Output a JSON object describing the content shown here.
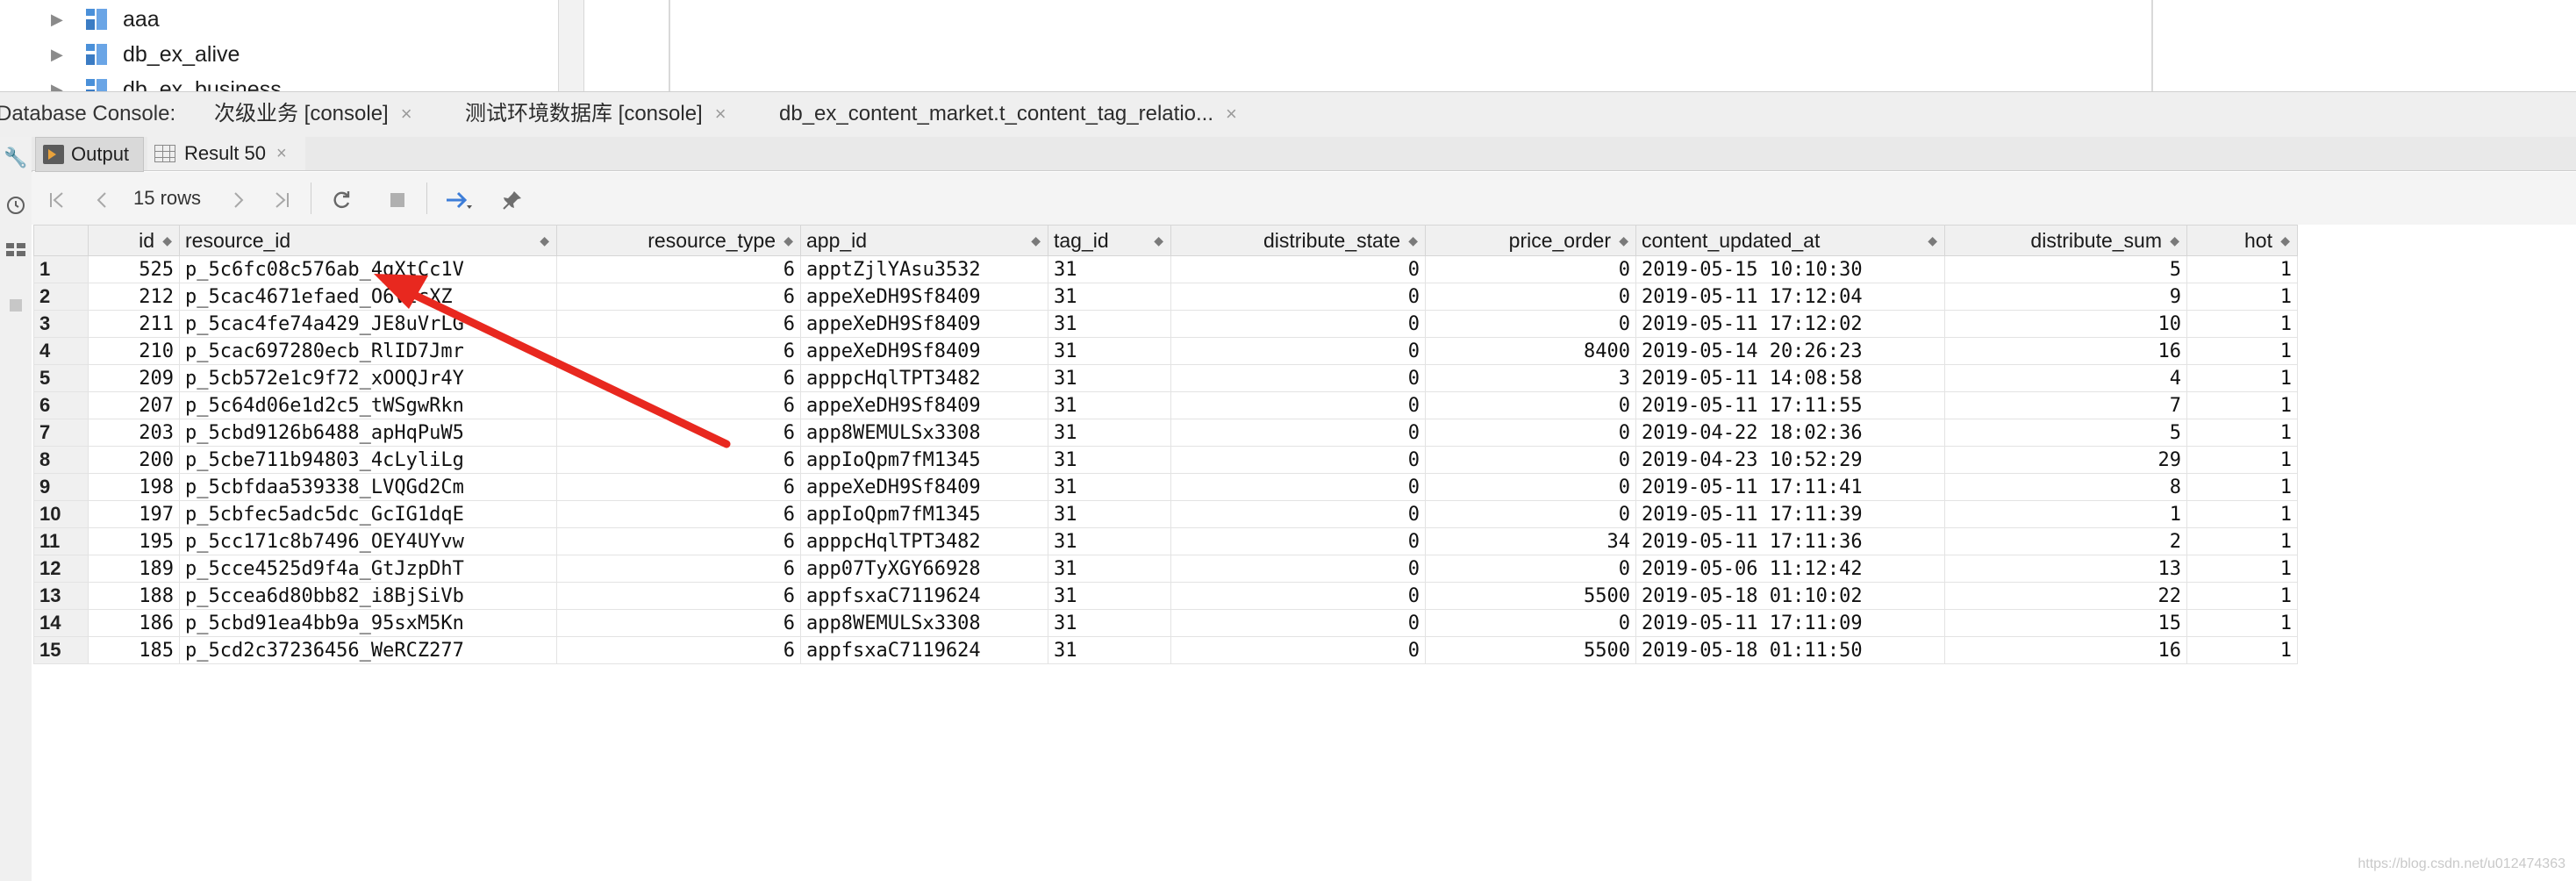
{
  "tree": {
    "items": [
      {
        "label": "aaa"
      },
      {
        "label": "db_ex_alive"
      },
      {
        "label": "db_ex_business"
      }
    ]
  },
  "console": {
    "label": "Database Console:",
    "tabs": [
      {
        "label": "次级业务 [console]"
      },
      {
        "label": "测试环境数据库 [console]"
      },
      {
        "label": "db_ex_content_market.t_content_tag_relatio..."
      }
    ],
    "close_glyph": "×"
  },
  "result_tabs": {
    "output_label": "Output",
    "result_label": "Result 50"
  },
  "toolbar": {
    "rows_label": "15 rows",
    "icons": [
      "first-page-icon",
      "prev-page-icon",
      "next-page-icon",
      "last-page-icon",
      "refresh-icon",
      "stop-icon",
      "compare-icon",
      "pin-icon"
    ]
  },
  "grid": {
    "columns": [
      {
        "label": "id"
      },
      {
        "label": "resource_id"
      },
      {
        "label": "resource_type"
      },
      {
        "label": "app_id"
      },
      {
        "label": "tag_id"
      },
      {
        "label": "distribute_state"
      },
      {
        "label": "price_order"
      },
      {
        "label": "content_updated_at"
      },
      {
        "label": "distribute_sum"
      },
      {
        "label": "hot"
      }
    ],
    "rows": [
      [
        "1",
        "525",
        "p_5c6fc08c576ab_4gXtCc1V",
        "6",
        "apptZjlYAsu3532",
        "31",
        "0",
        "0",
        "2019-05-15 10:10:30",
        "5",
        "1"
      ],
      [
        "2",
        "212",
        "p_5cac4671efaed_O6VzcXZ",
        "6",
        "appeXeDH9Sf8409",
        "31",
        "0",
        "0",
        "2019-05-11 17:12:04",
        "9",
        "1"
      ],
      [
        "3",
        "211",
        "p_5cac4fe74a429_JE8uVrLG",
        "6",
        "appeXeDH9Sf8409",
        "31",
        "0",
        "0",
        "2019-05-11 17:12:02",
        "10",
        "1"
      ],
      [
        "4",
        "210",
        "p_5cac697280ecb_RlID7Jmr",
        "6",
        "appeXeDH9Sf8409",
        "31",
        "0",
        "8400",
        "2019-05-14 20:26:23",
        "16",
        "1"
      ],
      [
        "5",
        "209",
        "p_5cb572e1c9f72_xOOQJr4Y",
        "6",
        "apppcHqlTPT3482",
        "31",
        "0",
        "3",
        "2019-05-11 14:08:58",
        "4",
        "1"
      ],
      [
        "6",
        "207",
        "p_5c64d06e1d2c5_tWSgwRkn",
        "6",
        "appeXeDH9Sf8409",
        "31",
        "0",
        "0",
        "2019-05-11 17:11:55",
        "7",
        "1"
      ],
      [
        "7",
        "203",
        "p_5cbd9126b6488_apHqPuW5",
        "6",
        "app8WEMULSx3308",
        "31",
        "0",
        "0",
        "2019-04-22 18:02:36",
        "5",
        "1"
      ],
      [
        "8",
        "200",
        "p_5cbe711b94803_4cLyliLg",
        "6",
        "appIoQpm7fM1345",
        "31",
        "0",
        "0",
        "2019-04-23 10:52:29",
        "29",
        "1"
      ],
      [
        "9",
        "198",
        "p_5cbfdaa539338_LVQGd2Cm",
        "6",
        "appeXeDH9Sf8409",
        "31",
        "0",
        "0",
        "2019-05-11 17:11:41",
        "8",
        "1"
      ],
      [
        "10",
        "197",
        "p_5cbfec5adc5dc_GcIG1dqE",
        "6",
        "appIoQpm7fM1345",
        "31",
        "0",
        "0",
        "2019-05-11 17:11:39",
        "1",
        "1"
      ],
      [
        "11",
        "195",
        "p_5cc171c8b7496_OEY4UYvw",
        "6",
        "apppcHqlTPT3482",
        "31",
        "0",
        "34",
        "2019-05-11 17:11:36",
        "2",
        "1"
      ],
      [
        "12",
        "189",
        "p_5cce4525d9f4a_GtJzpDhT",
        "6",
        "app07TyXGY66928",
        "31",
        "0",
        "0",
        "2019-05-06 11:12:42",
        "13",
        "1"
      ],
      [
        "13",
        "188",
        "p_5ccea6d80bb82_i8BjSiVb",
        "6",
        "appfsxaC7119624",
        "31",
        "0",
        "5500",
        "2019-05-18 01:10:02",
        "22",
        "1"
      ],
      [
        "14",
        "186",
        "p_5cbd91ea4bb9a_95sxM5Kn",
        "6",
        "app8WEMULSx3308",
        "31",
        "0",
        "0",
        "2019-05-11 17:11:09",
        "15",
        "1"
      ],
      [
        "15",
        "185",
        "p_5cd2c37236456_WeRCZ277",
        "6",
        "appfsxaC7119624",
        "31",
        "0",
        "5500",
        "2019-05-18 01:11:50",
        "16",
        "1"
      ]
    ]
  },
  "annotation": {
    "color": "#e8281f"
  },
  "watermark": "https://blog.csdn.net/u012474363"
}
